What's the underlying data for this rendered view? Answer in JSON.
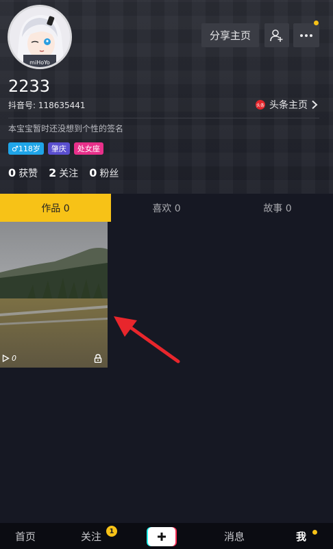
{
  "profile": {
    "avatar_text": "miHoYo",
    "username": "2233",
    "user_id": "抖音号: 118635441",
    "toutiao_logo_text": "头条",
    "toutiao_link": "头条主页",
    "bio": "本宝宝暂时还没想到个性的签名",
    "tags": {
      "age": "♂118岁",
      "city": "肇庆",
      "zodiac": "处女座"
    },
    "stats": {
      "likes_count": "0",
      "likes_label": "获赞",
      "following_count": "2",
      "following_label": "关注",
      "followers_count": "0",
      "followers_label": "粉丝"
    }
  },
  "header_buttons": {
    "share_label": "分享主页",
    "add_user_icon": "add-user-icon",
    "more_icon": "more-dots-icon"
  },
  "tabs": [
    {
      "label": "作品 0",
      "active": true
    },
    {
      "label": "喜欢 0",
      "active": false
    },
    {
      "label": "故事 0",
      "active": false
    }
  ],
  "video": {
    "play_count": "0",
    "locked": true
  },
  "bottom_nav": {
    "home": "首页",
    "following": "关注",
    "following_badge": "1",
    "messages": "消息",
    "me": "我"
  },
  "colors": {
    "accent": "#f7c217",
    "background": "#161823",
    "arrow": "#e8262c"
  }
}
